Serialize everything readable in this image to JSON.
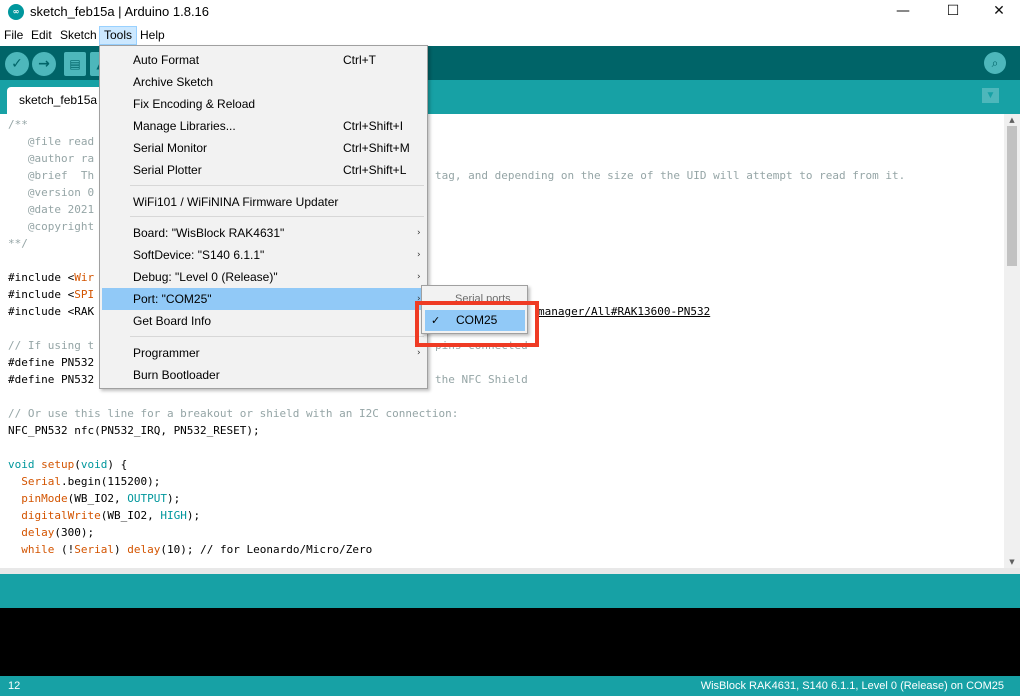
{
  "window": {
    "title": "sketch_feb15a | Arduino 1.8.16",
    "app_icon": "arduino-infinity-icon",
    "minimize_glyph": "—",
    "maximize_glyph": "☐",
    "close_glyph": "✕"
  },
  "menubar": {
    "items": [
      "File",
      "Edit",
      "Sketch",
      "Tools",
      "Help"
    ],
    "active": "Tools"
  },
  "toolbar": {
    "icons": [
      "verify-icon",
      "upload-icon",
      "new-icon",
      "open-icon",
      "serial-monitor-icon"
    ]
  },
  "tabs": [
    {
      "label": "sketch_feb15a"
    }
  ],
  "editor": {
    "lines": {
      "l1": "/**",
      "l2": "   @file read",
      "l3": "   @author ra",
      "l4": "   @brief  Th",
      "l4_tail": "tag, and depending on the size of the UID will attempt to read from it.",
      "l5": "   @version 0",
      "l6": "   @date 2021",
      "l7": "   @copyright",
      "l8": "**/",
      "inc1_a": "#include <",
      "inc1_b": "Wir",
      "inc2_a": "#include <",
      "inc2_b": "SPI",
      "inc3_a": "#include <RAK",
      "inc3_tail": "manager/All#RAK13600-PN532",
      "c1": "// If using t",
      "c1_tail": "pins connected",
      "def1": "#define PN532",
      "def2": "#define PN532",
      "def2_tail": "the NFC Shield",
      "c2": "// Or use this line for a breakout or shield with an I2C connection:",
      "nfc": "NFC_PN532 nfc(PN532_IRQ, PN532_RESET);",
      "setup_kw": "void",
      "setup_fn": "setup",
      "setup_arg": "void",
      "serial_obj": "Serial",
      "serial_call": ".begin(115200);",
      "pinmode_fn": "pinMode",
      "pinmode_arg_a": "(WB_IO2, ",
      "pinmode_arg_b": "OUTPUT",
      "dw_fn": "digitalWrite",
      "dw_arg_a": "(WB_IO2, ",
      "dw_arg_b": "HIGH",
      "delay_fn": "delay",
      "delay_arg": "(300);",
      "while_kw": "while",
      "while_obj": "Serial",
      "while_delay": "delay",
      "while_tail": "(10); // for Leonardo/Micro/Zero"
    }
  },
  "tools_menu": {
    "items": [
      {
        "label": "Auto Format",
        "shortcut": "Ctrl+T"
      },
      {
        "label": "Archive Sketch",
        "shortcut": ""
      },
      {
        "label": "Fix Encoding & Reload",
        "shortcut": ""
      },
      {
        "label": "Manage Libraries...",
        "shortcut": "Ctrl+Shift+I"
      },
      {
        "label": "Serial Monitor",
        "shortcut": "Ctrl+Shift+M"
      },
      {
        "label": "Serial Plotter",
        "shortcut": "Ctrl+Shift+L"
      },
      {
        "label": "WiFi101 / WiFiNINA Firmware Updater",
        "shortcut": ""
      },
      {
        "label": "Board: \"WisBlock RAK4631\"",
        "shortcut": ""
      },
      {
        "label": "SoftDevice: \"S140  6.1.1\"",
        "shortcut": ""
      },
      {
        "label": "Debug: \"Level 0 (Release)\"",
        "shortcut": ""
      },
      {
        "label": "Port: \"COM25\"",
        "shortcut": ""
      },
      {
        "label": "Get Board Info",
        "shortcut": ""
      },
      {
        "label": "Programmer",
        "shortcut": ""
      },
      {
        "label": "Burn Bootloader",
        "shortcut": ""
      }
    ],
    "highlighted": "Port: \"COM25\"",
    "submenu_arrow": "›"
  },
  "port_submenu": {
    "header": "Serial ports",
    "item": "COM25",
    "checked": true,
    "check_glyph": "✓"
  },
  "status": {
    "line_number": "12",
    "board_info": "WisBlock RAK4631, S140  6.1.1, Level 0 (Release) on COM25"
  },
  "colors": {
    "toolbar": "#006468",
    "tabstrip": "#17a1a5",
    "menu_highlight": "#91c9f7",
    "annotation_box": "#ef3b24"
  }
}
